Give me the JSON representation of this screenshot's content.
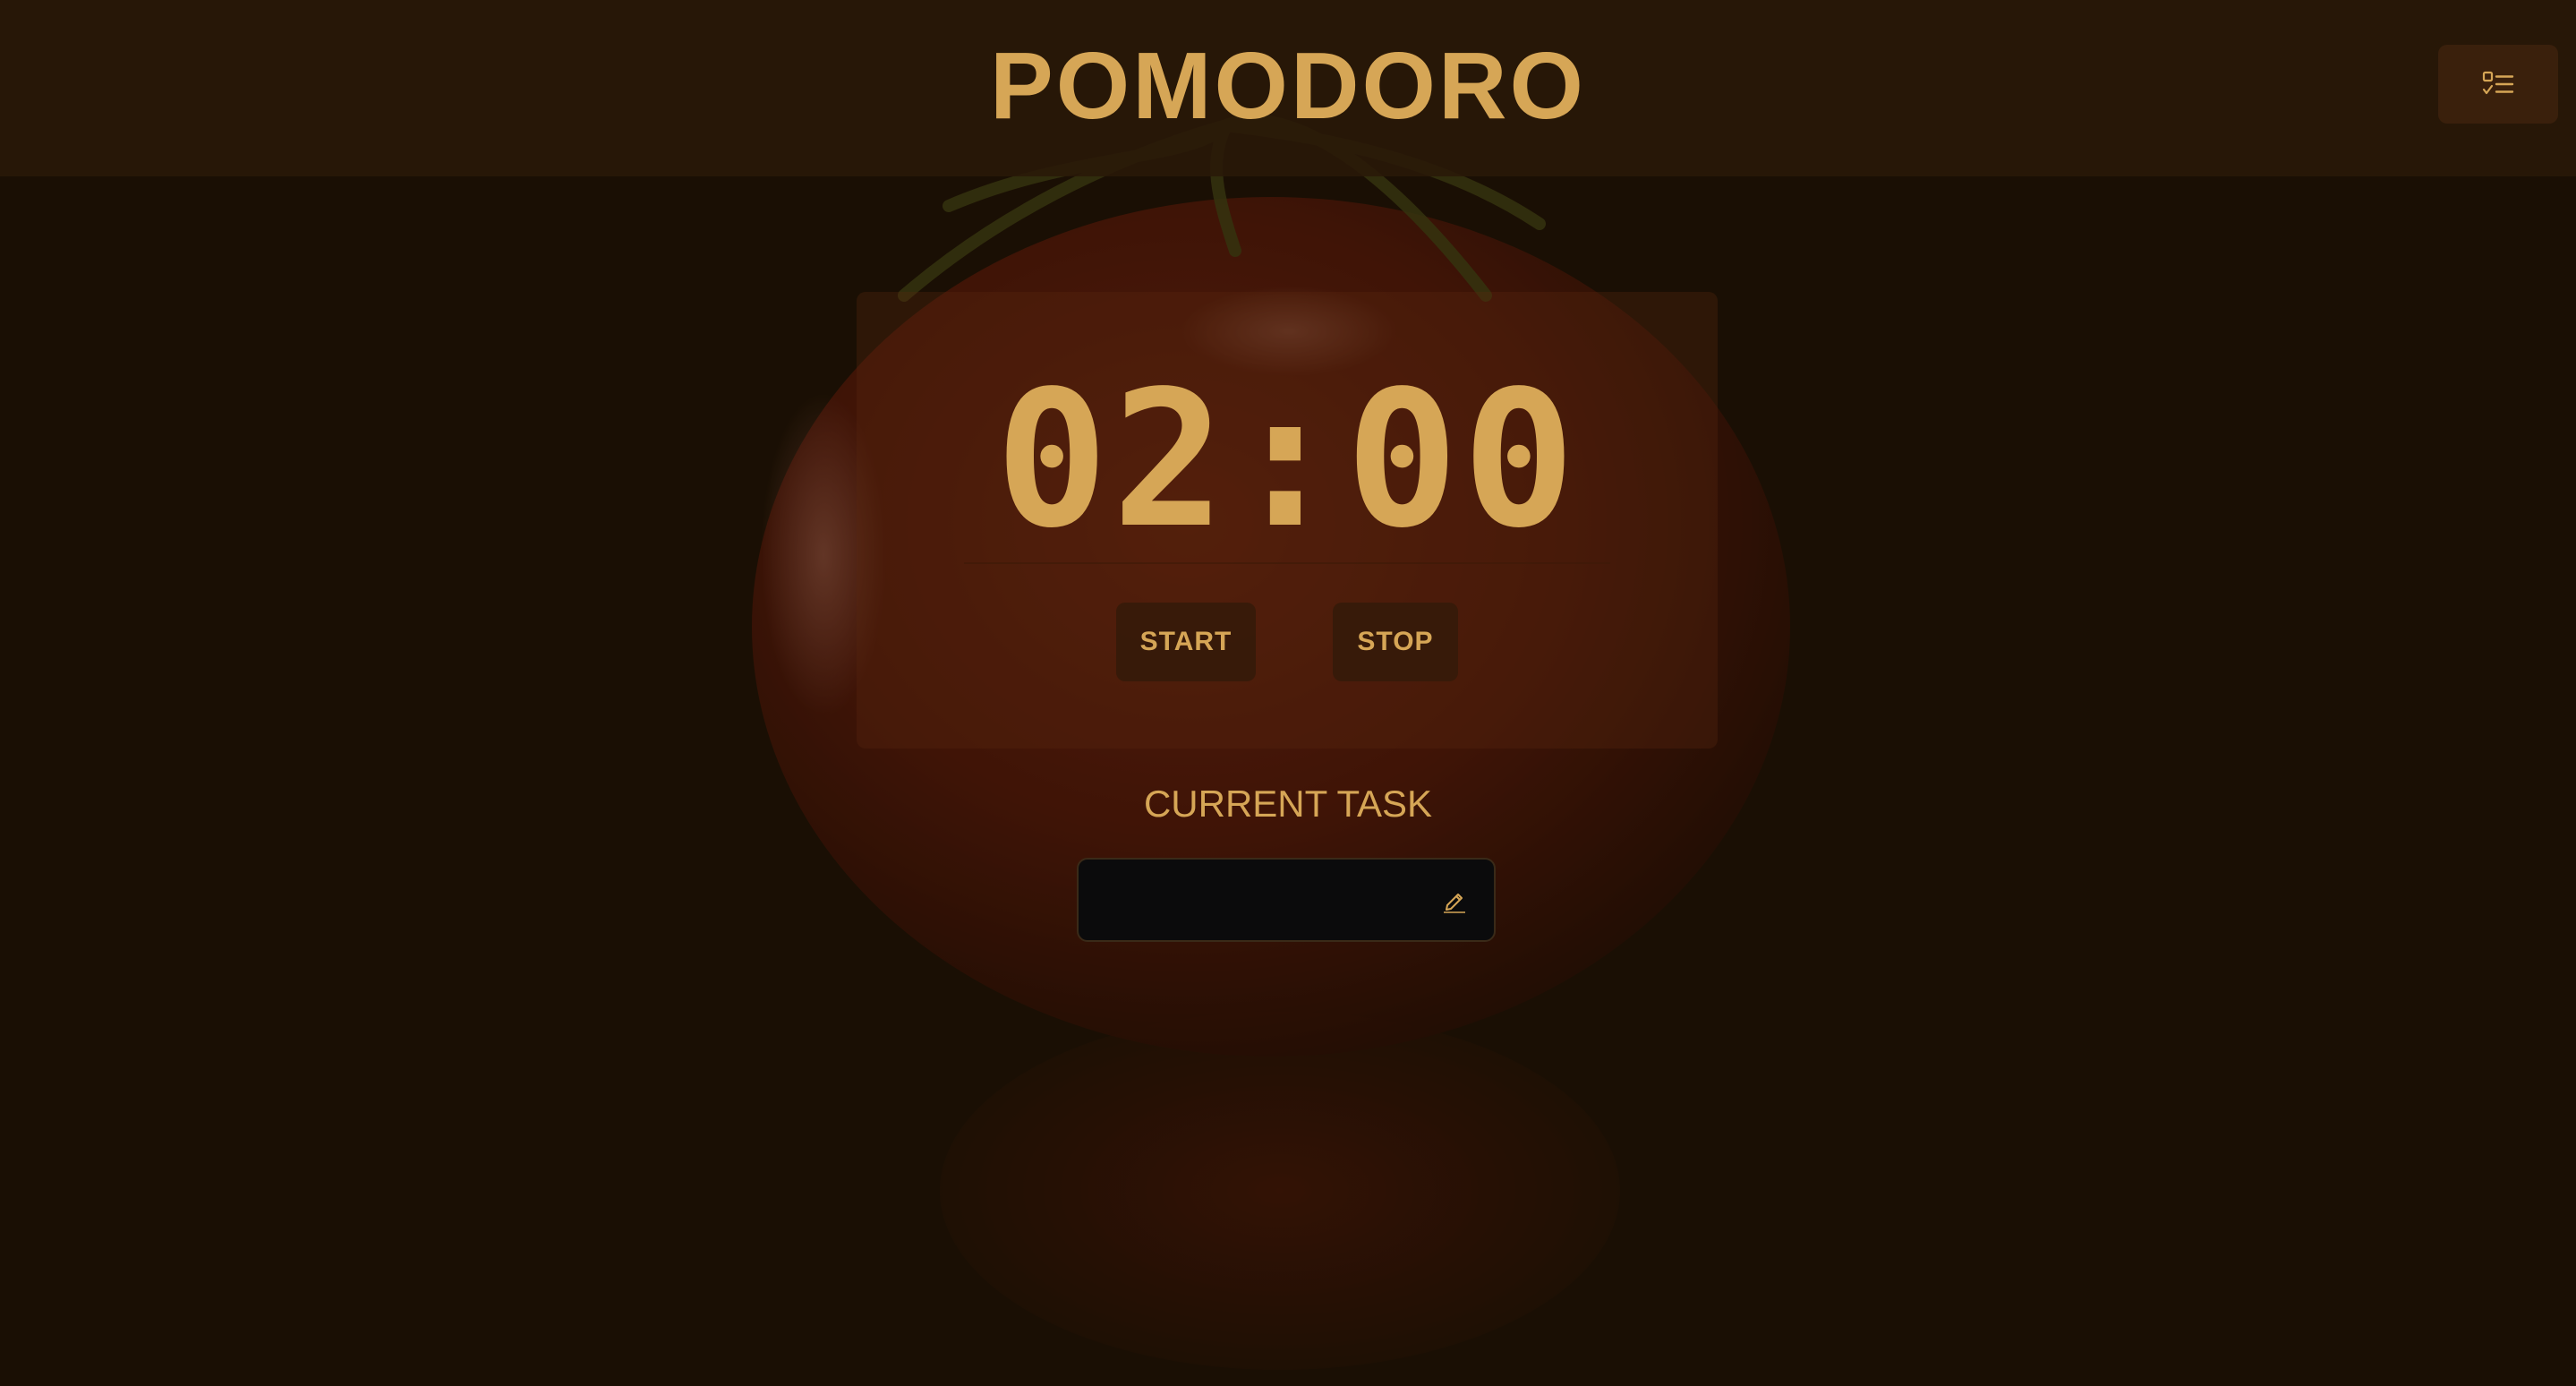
{
  "header": {
    "title": "POMODORO",
    "tasks_button_icon": "task-list-icon"
  },
  "timer": {
    "display": "02:00",
    "start_label": "START",
    "stop_label": "STOP"
  },
  "task": {
    "heading": "CURRENT TASK",
    "value": "",
    "edit_icon": "pencil-icon"
  },
  "theme": {
    "accent": "#d6a656",
    "background": "#1b1004",
    "header_bg": "#2a1808",
    "button_bg": "#3a200c",
    "input_bg": "#0b0b0c",
    "tomato": "#7a1c0c"
  },
  "background_image": "tomato-photo"
}
